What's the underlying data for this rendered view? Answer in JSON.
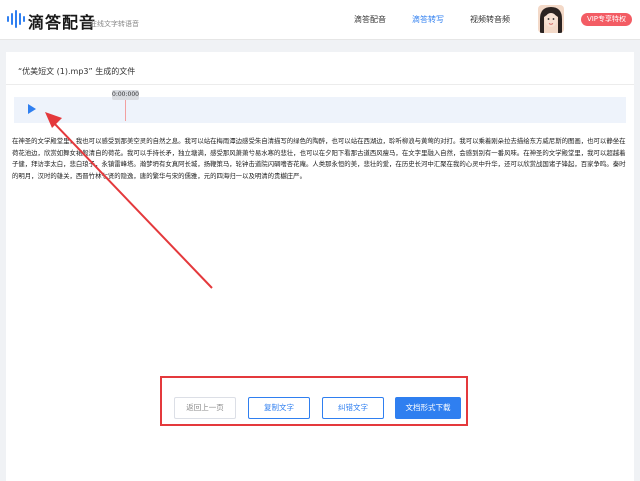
{
  "header": {
    "brand": "滴答配音",
    "slogan": "在线文字转语音",
    "nav": [
      "滴答配音",
      "滴答转写",
      "视频转音频"
    ],
    "active_nav_color": "#2f7ff0",
    "vip_label": "VIP专享特权"
  },
  "main": {
    "file_title": "“优美短文 (1).mp3”  生成的文件",
    "player": {
      "time": "0:00:000"
    },
    "transcript": "在神圣的文学殿堂里，我也可以感受到那美空灵的自然之息。我可以站在梅雨潭边感受朱自清描写的绿色的陶醉，也可以站在西湖边，聆听柳浪与黄莺的对打。我可以乘着刚朵拉去描绘东方威尼斯的图画，也可以静坐在荷花池边，欣赏如舞女裙般清自的荷花。我可以手持长矛，独立塘满，感受那风萧萧兮易水寒的悲壮，也可以在夕阳下看那古道西风瘦马，在文字里融入自然，会感到别有一番风味。在神圣的文学殿堂里，我可以超越着子健，拜访李太白，悲白琅子，永镇雷峰塔。瀚梦坍有女真阿长城，扬鞭策马，轮钟击道院闪碉嗜杏花庵。人类那永恒的美，悲壮的爱，在历史长河中汇聚在我的心灵中升华，还可以欣赏战国诸子锋起，百家争鸣。秦时的明月，汉时的雄关，西晋竹林七贤的隐逸，唐的繁华与宋的儒雅，元的四海归一以及明清的贵樾庄严。"
  },
  "actions": {
    "back": "返回上一页",
    "copy": "复制文字",
    "correct": "纠错文字",
    "download": "文档形式下载"
  },
  "colors": {
    "accent": "#2f7ff0",
    "annotation": "#e4393c",
    "vip": "#f35c64"
  }
}
